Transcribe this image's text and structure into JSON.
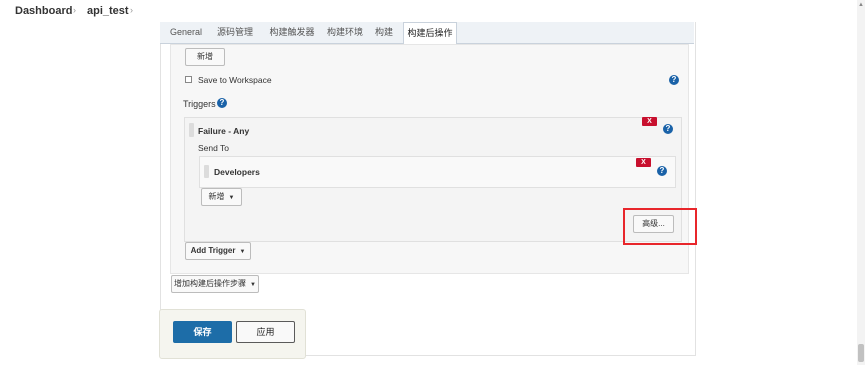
{
  "breadcrumb": {
    "dashboard": "Dashboard",
    "job": "api_test",
    "sep": "›"
  },
  "tabs": [
    {
      "label": "General"
    },
    {
      "label": "源码管理"
    },
    {
      "label": "构建触发器"
    },
    {
      "label": "构建环境"
    },
    {
      "label": "构建"
    },
    {
      "label": "构建后操作",
      "active": true
    }
  ],
  "config": {
    "add_button": "新增",
    "save_to_workspace": "Save to Workspace",
    "triggers_label": "Triggers",
    "trigger": {
      "title": "Failure - Any",
      "send_to": "Send To",
      "recipient": "Developers",
      "add_button": "新增",
      "advanced_button": "高级...",
      "delete_label": "X"
    },
    "add_trigger_button": "Add Trigger",
    "help_icon": "?"
  },
  "post_build_add_button": "增加构建后操作步骤",
  "footer": {
    "save": "保存",
    "apply": "应用"
  },
  "colors": {
    "primary": "#1d6da8",
    "danger": "#c8102e",
    "highlight": "#e8262b"
  }
}
